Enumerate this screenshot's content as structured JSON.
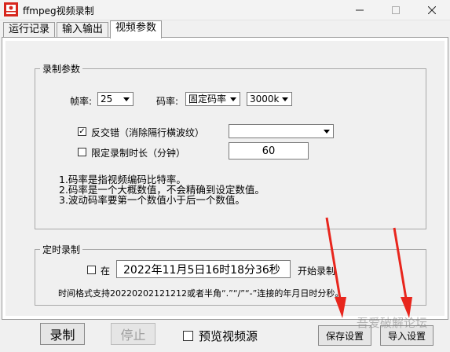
{
  "window": {
    "title": "ffmpeg视频录制"
  },
  "tabs": [
    {
      "label": "运行记录"
    },
    {
      "label": "输入输出"
    },
    {
      "label": "视频参数"
    }
  ],
  "record_params": {
    "legend": "录制参数",
    "fps_label": "帧率:",
    "fps_value": "25",
    "bitrate_label": "码率:",
    "bitrate_mode_value": "固定码率",
    "bitrate_value": "3000k",
    "deinterlace_check": "✓",
    "deinterlace_label": "反交错（消除隔行横波纹）",
    "deinterlace_value": "",
    "limit_duration_label": "限定录制时长（分钟）",
    "limit_duration_value": "60",
    "notes": [
      "1.码率是指视频编码比特率。",
      "2.码率是一个大概数值，不会精确到设定数值。",
      "3.波动码率要第一个数值小于后一个数值。"
    ]
  },
  "timed_record": {
    "legend": "定时录制",
    "at_label": "在",
    "datetime_value": "2022年11月5日16时18分36秒",
    "start_label": "开始录制",
    "format_hint": "时间格式支持20220202121212或者半角“.”“/”“-”连接的年月日时分秒。"
  },
  "bottom": {
    "record_button": "录制",
    "stop_button": "停止",
    "preview_label": "预览视频源",
    "save_settings_button": "保存设置",
    "import_settings_button": "导入设置"
  },
  "watermark": "吾爱破解论坛",
  "colors": {
    "arrow_red": "#e8261d",
    "icon_red": "#d7261d"
  },
  "icons": {
    "app": "app-logo-icon",
    "minimize": "minimize-icon",
    "maximize": "maximize-icon",
    "close": "close-icon",
    "dropdown": "chevron-down-icon",
    "annotation": "red-arrow-icon"
  }
}
